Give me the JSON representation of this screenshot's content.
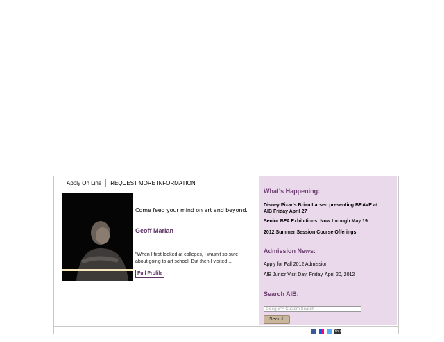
{
  "top_links": {
    "apply": "Apply On Line",
    "request": "REQUEST MORE INFORMATION"
  },
  "feature": {
    "tagline": "Come feed your mind on art and beyond.",
    "name": "Geoff Marian",
    "quote": "\"When I first looked at colleges, I wasn't so sure about going to art school. But then I visited ...",
    "profile_button": "Full Profile"
  },
  "sidebar": {
    "happening_title": "What's Happening:",
    "happening_items": [
      "Disney Pixar's Brian Larsen presenting BRAVE at AIB Friday April 27",
      "Senior BFA Exhibitions: Now through May 19",
      "2012 Summer Session Course Offerings"
    ],
    "admission_title": "Admission News:",
    "admission_items": [
      "Apply for Fall 2012 Admission",
      "AIB Junior Visit Day: Friday, April 20, 2012"
    ],
    "search_title": "Search AIB:",
    "search_logo": "Google™",
    "search_placeholder": "Custom Search",
    "search_button": "Search"
  },
  "social": {
    "icons": [
      "facebook-icon",
      "flickr-icon",
      "twitter-icon",
      "youtube-icon"
    ],
    "youtube_label": "You"
  },
  "colors": {
    "accent": "#6d3f72",
    "sidebar_bg": "#ead9ea",
    "button": "#c9b79d"
  }
}
